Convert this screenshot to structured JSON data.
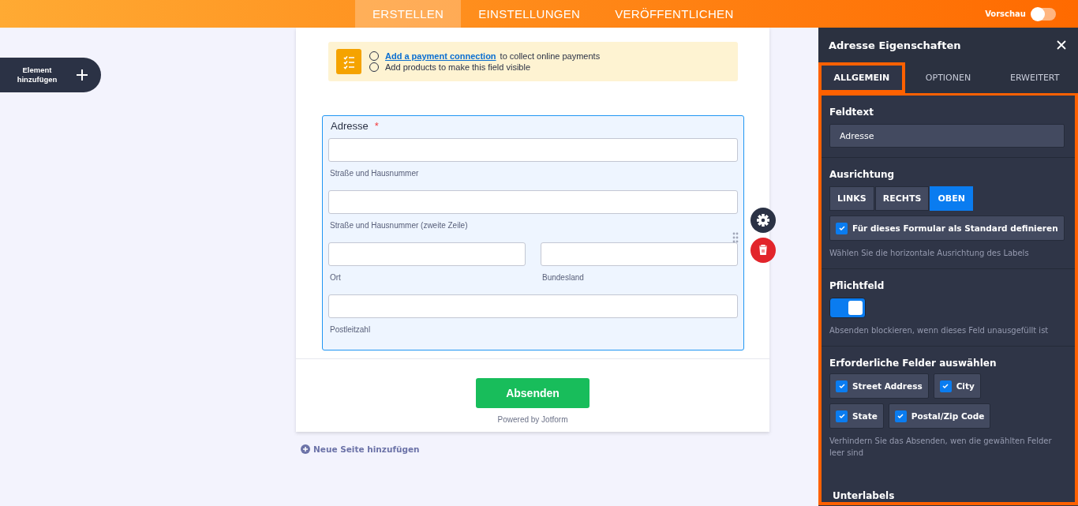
{
  "nav": {
    "tabs": [
      {
        "label": "ERSTELLEN",
        "selected": true
      },
      {
        "label": "EINSTELLUNGEN",
        "selected": false
      },
      {
        "label": "VERÖFFENTLICHEN",
        "selected": false
      }
    ],
    "preview": {
      "label": "Vorschau",
      "on": false
    }
  },
  "add_element": {
    "label": "Element hinzufügen"
  },
  "notice": {
    "items": [
      {
        "link": "Add a payment connection",
        "text": "to collect online payments",
        "checked": false
      },
      {
        "text": "Add products to make this field visible",
        "checked": false
      }
    ]
  },
  "address_field": {
    "label": "Adresse",
    "required": true,
    "required_mark": "*",
    "selected": true,
    "rows": [
      [
        {
          "sublabel": "Straße und Hausnummer"
        }
      ],
      [
        {
          "sublabel": "Straße und Hausnummer (zweite Zeile)"
        }
      ],
      [
        {
          "sublabel": "Ort"
        },
        {
          "sublabel": "Bundesland"
        }
      ],
      [
        {
          "sublabel": "Postleitzahl"
        }
      ]
    ]
  },
  "submit": {
    "label": "Absenden",
    "powered_by": "Powered by Jotform"
  },
  "add_page": {
    "label": "Neue Seite hinzufügen"
  },
  "panel": {
    "title": "Adresse Eigenschaften",
    "tabs": [
      {
        "label": "ALLGEMEIN",
        "selected": true
      },
      {
        "label": "OPTIONEN",
        "selected": false
      },
      {
        "label": "ERWEITERT",
        "selected": false
      }
    ],
    "field_text": {
      "label": "Feldtext",
      "value": "Adresse"
    },
    "alignment": {
      "label": "Ausrichtung",
      "options": [
        {
          "label": "LINKS",
          "selected": false
        },
        {
          "label": "RECHTS",
          "selected": false
        },
        {
          "label": "OBEN",
          "selected": true
        }
      ],
      "default": {
        "label": "Für dieses Formular als Standard definieren",
        "checked": true
      },
      "hint": "Wählen Sie die horizontale Ausrichtung des Labels"
    },
    "required": {
      "label": "Pflichtfeld",
      "on": true,
      "hint": "Absenden blockieren, wenn dieses Feld unausgefüllt ist"
    },
    "required_fields": {
      "label": "Erforderliche Felder auswählen",
      "rows": [
        [
          {
            "label": "Street Address",
            "checked": true
          },
          {
            "label": "City",
            "checked": true
          }
        ],
        [
          {
            "label": "State",
            "checked": true
          },
          {
            "label": "Postal/Zip Code",
            "checked": true
          }
        ]
      ],
      "hint": "Verhindern Sie das Absenden, wen die gewählten Felder leer sind"
    },
    "next_section": {
      "label": "Unterlabels"
    }
  }
}
